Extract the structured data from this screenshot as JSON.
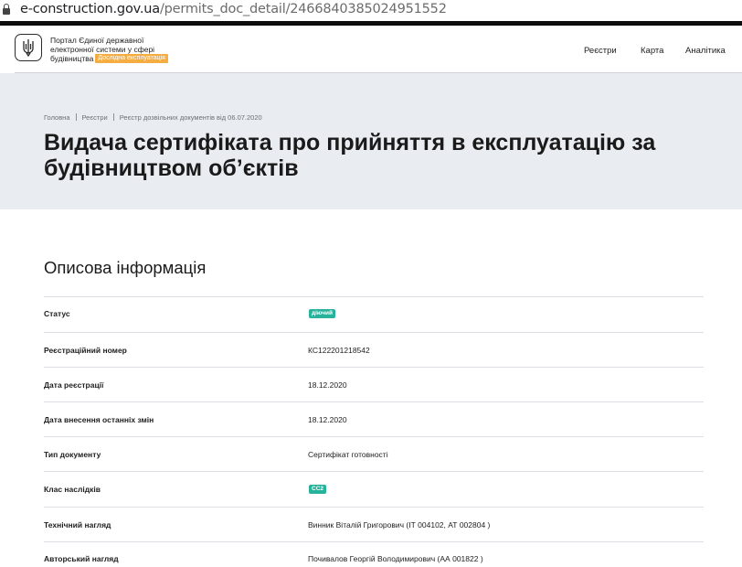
{
  "browser": {
    "url_host": "e-construction.gov.ua",
    "url_path": "/permits_doc_detail/2466840385024951552"
  },
  "header": {
    "portal_line1": "Портал Єдиної державної",
    "portal_line2": "електронної системи у сфері",
    "portal_line3": "будівництва",
    "test_badge": "Дослідна експлуатація",
    "nav": [
      "Реєстри",
      "Карта",
      "Аналітика"
    ]
  },
  "breadcrumb": [
    "Головна",
    "Реєстри",
    "Реєстр дозвільних документів від 06.07.2020"
  ],
  "page_title_line1": "Видача сертифіката про прийняття в експлуатацію за",
  "page_title_line2": "будівництвом об’єктів",
  "section_title": "Описова інформація",
  "fields": [
    {
      "label": "Статус",
      "value": "діючий",
      "kind": "pill"
    },
    {
      "label": "Реєстраційний номер",
      "value": "КС122201218542",
      "kind": "text"
    },
    {
      "label": "Дата реєстрації",
      "value": "18.12.2020",
      "kind": "text"
    },
    {
      "label": "Дата внесення останніх змін",
      "value": "18.12.2020",
      "kind": "text"
    },
    {
      "label": "Тип документу",
      "value": "Сертифікат готовності",
      "kind": "text"
    },
    {
      "label": "Клас наслідків",
      "value": "СС2",
      "kind": "pill"
    },
    {
      "label": "Технічний нагляд",
      "value": "Винник Віталій Григорович (ІТ 004102, АТ 002804 )",
      "kind": "text"
    },
    {
      "label": "Авторський нагляд",
      "value": "Почивалов Георгій Володимирович (АА 001822 )",
      "kind": "text"
    }
  ],
  "colors": {
    "pill": "#27b39b",
    "test_badge": "#f5ad42",
    "hero_bg": "#e9ecf0"
  },
  "icons": [
    "lock-icon",
    "trident-coat-of-arms-icon"
  ]
}
